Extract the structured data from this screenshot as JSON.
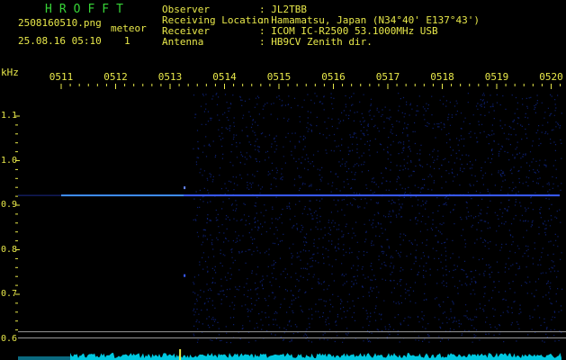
{
  "header": {
    "app_title": "HROFFT",
    "filename": "2508160510.png",
    "datetime": "25.08.16 05:10",
    "meteor_label": "meteor",
    "meteor_count": "1",
    "observer_label": "Observer",
    "observer_value": ": JL2TBB",
    "location_label": "Receiving Location",
    "location_value": ": Hamamatsu, Japan (N34°40' E137°43')",
    "receiver_label": "Receiver",
    "receiver_value": ": ICOM IC-R2500 53.1000MHz USB",
    "antenna_label": "Antenna",
    "antenna_value": ": HB9CV Zenith dir."
  },
  "colors": {
    "text_yellow": "#e8e84a",
    "title_green": "#37d437",
    "background": "#000000",
    "carrier_blue": "#3a5cff",
    "noise_cyan": "#00c8e0",
    "grid_gray": "#9a9a9a"
  },
  "chart_data": {
    "type": "heatmap",
    "y_unit": "kHz",
    "x_ticks": [
      "0511",
      "0512",
      "0513",
      "0514",
      "0515",
      "0516",
      "0517",
      "0518",
      "0519",
      "0520"
    ],
    "y_ticks": [
      {
        "label": "1.1",
        "value": 1.1
      },
      {
        "label": "1.0",
        "value": 1.0
      },
      {
        "label": "0.9",
        "value": 0.9
      },
      {
        "label": "0.8",
        "value": 0.8
      },
      {
        "label": "0.7",
        "value": 0.7
      },
      {
        "label": "0.6",
        "value": 0.6
      }
    ],
    "y_range": [
      0.58,
      1.16
    ],
    "x_range_minutes": [
      10.6,
      20.3
    ],
    "carrier_frequency": 0.922,
    "carrier_start_minute": 11.0,
    "reference_lines": [
      0.616,
      0.602
    ],
    "meteor_echo_minute": 13.25
  }
}
